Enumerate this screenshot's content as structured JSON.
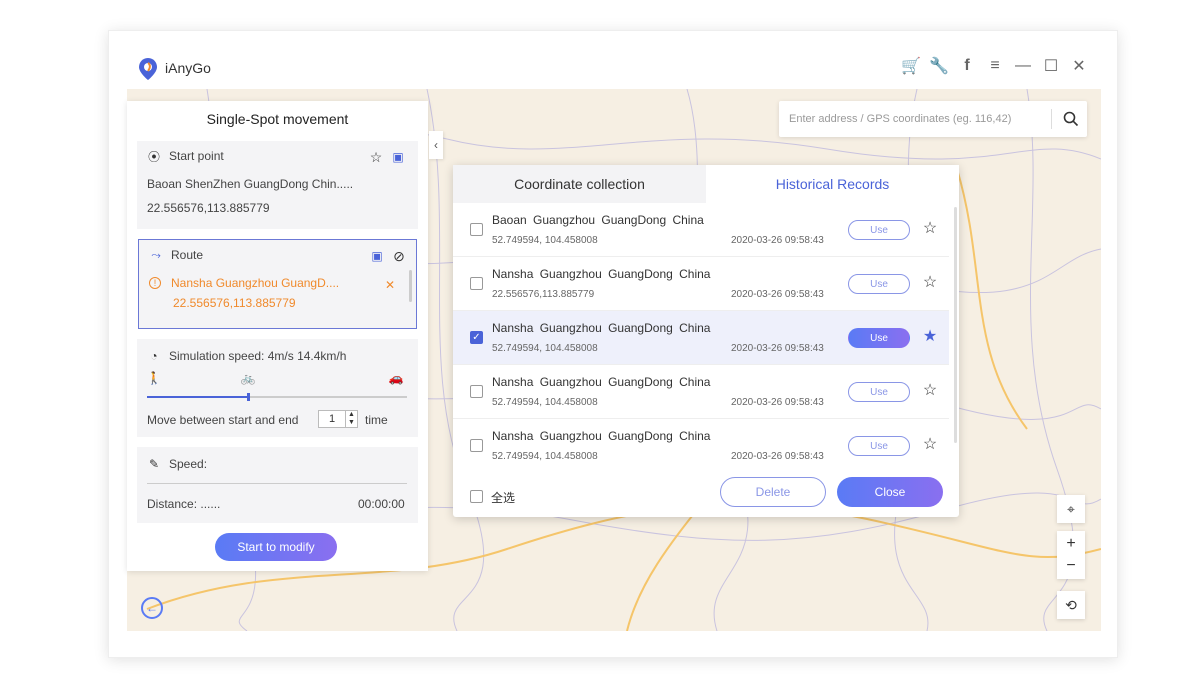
{
  "app": {
    "title": "iAnyGo"
  },
  "window_controls": [
    "cart-icon",
    "wrench-icon",
    "facebook-icon",
    "menu-icon",
    "minimize-icon",
    "maximize-icon",
    "close-icon"
  ],
  "left_panel": {
    "title": "Single-Spot movement",
    "start_point": {
      "label": "Start point",
      "address": "Baoan  ShenZhen  GuangDong Chin.....",
      "coords": "22.556576,113.885779"
    },
    "route": {
      "label": "Route",
      "address": "Nansha  Guangzhou  GuangD....",
      "coords": "22.556576,113.885779"
    },
    "simulation": {
      "label": "Simulation speed:  4m/s   14.4km/h",
      "move_label": "Move between start and end",
      "times_value": "1",
      "times_unit": "time"
    },
    "speed": {
      "label": "Speed:",
      "distance_label": "Distance: ......",
      "duration": "00:00:00"
    },
    "start_button": "Start to modify"
  },
  "search": {
    "placeholder": "Enter address / GPS coordinates (eg. 116,42)"
  },
  "dialog": {
    "tabs": [
      {
        "label": "Coordinate collection",
        "active": false
      },
      {
        "label": "Historical Records",
        "active": true
      }
    ],
    "records": [
      {
        "name": "Baoan  Guangzhou  GuangDong China",
        "coords": "52.749594, 104.458008",
        "time": "2020-03-26 09:58:43",
        "use": "Use",
        "checked": false,
        "starred": false
      },
      {
        "name": "Nansha  Guangzhou  GuangDong China",
        "coords": "22.556576,113.885779",
        "time": "2020-03-26 09:58:43",
        "use": "Use",
        "checked": false,
        "starred": false
      },
      {
        "name": "Nansha  Guangzhou  GuangDong China",
        "coords": "52.749594, 104.458008",
        "time": "2020-03-26 09:58:43",
        "use": "Use",
        "checked": true,
        "starred": true
      },
      {
        "name": "Nansha  Guangzhou  GuangDong China",
        "coords": "52.749594, 104.458008",
        "time": "2020-03-26 09:58:43",
        "use": "Use",
        "checked": false,
        "starred": false
      },
      {
        "name": "Nansha  Guangzhou  GuangDong China",
        "coords": "52.749594, 104.458008",
        "time": "2020-03-26 09:58:43",
        "use": "Use",
        "checked": false,
        "starred": false
      }
    ],
    "select_all": "全选",
    "delete_button": "Delete",
    "close_button": "Close"
  },
  "colors": {
    "accent": "#4a63d8",
    "route_orange": "#f08a2c",
    "map_bg": "#f6efe3"
  }
}
